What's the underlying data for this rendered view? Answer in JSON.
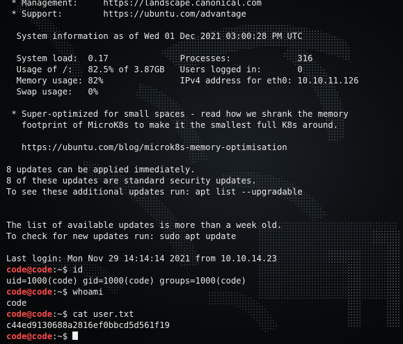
{
  "lines": [
    {
      "type": "text",
      "text": " * Management:     https://landscape.canonical.com"
    },
    {
      "type": "text",
      "text": " * Support:        https://ubuntu.com/advantage"
    },
    {
      "type": "text",
      "text": ""
    },
    {
      "type": "text",
      "text": "  System information as of Wed 01 Dec 2021 03:00:28 PM UTC"
    },
    {
      "type": "text",
      "text": ""
    },
    {
      "type": "text",
      "text": "  System load:  0.17              Processes:             316"
    },
    {
      "type": "text",
      "text": "  Usage of /:   82.5% of 3.87GB   Users logged in:       0"
    },
    {
      "type": "text",
      "text": "  Memory usage: 82%               IPv4 address for eth0: 10.10.11.126"
    },
    {
      "type": "text",
      "text": "  Swap usage:   0%"
    },
    {
      "type": "text",
      "text": ""
    },
    {
      "type": "text",
      "text": " * Super-optimized for small spaces - read how we shrank the memory"
    },
    {
      "type": "text",
      "text": "   footprint of MicroK8s to make it the smallest full K8s around."
    },
    {
      "type": "text",
      "text": ""
    },
    {
      "type": "text",
      "text": "   https://ubuntu.com/blog/microk8s-memory-optimisation"
    },
    {
      "type": "text",
      "text": ""
    },
    {
      "type": "text",
      "text": "8 updates can be applied immediately."
    },
    {
      "type": "text",
      "text": "8 of these updates are standard security updates."
    },
    {
      "type": "text",
      "text": "To see these additional updates run: apt list --upgradable"
    },
    {
      "type": "text",
      "text": ""
    },
    {
      "type": "text",
      "text": ""
    },
    {
      "type": "text",
      "text": "The list of available updates is more than a week old."
    },
    {
      "type": "text",
      "text": "To check for new updates run: sudo apt update"
    },
    {
      "type": "text",
      "text": ""
    },
    {
      "type": "text",
      "text": "Last login: Mon Nov 29 14:14:14 2021 from 10.10.14.23"
    },
    {
      "type": "prompt",
      "user": "code@code",
      "path": ":~$ ",
      "command": "id"
    },
    {
      "type": "text",
      "text": "uid=1000(code) gid=1000(code) groups=1000(code)"
    },
    {
      "type": "prompt",
      "user": "code@code",
      "path": ":~$ ",
      "command": "whoami"
    },
    {
      "type": "text",
      "text": "code"
    },
    {
      "type": "prompt",
      "user": "code@code",
      "path": ":~$ ",
      "command": "cat user.txt"
    },
    {
      "type": "text",
      "text": "c44ed9130688a2816ef0bbcd5d561f19"
    },
    {
      "type": "prompt",
      "user": "code@code",
      "path": ":~$ ",
      "command": "",
      "cursor": true
    }
  ],
  "colors": {
    "prompt_user": "#ff4b4b",
    "foreground": "#e6e6e6",
    "background": "#050607"
  }
}
